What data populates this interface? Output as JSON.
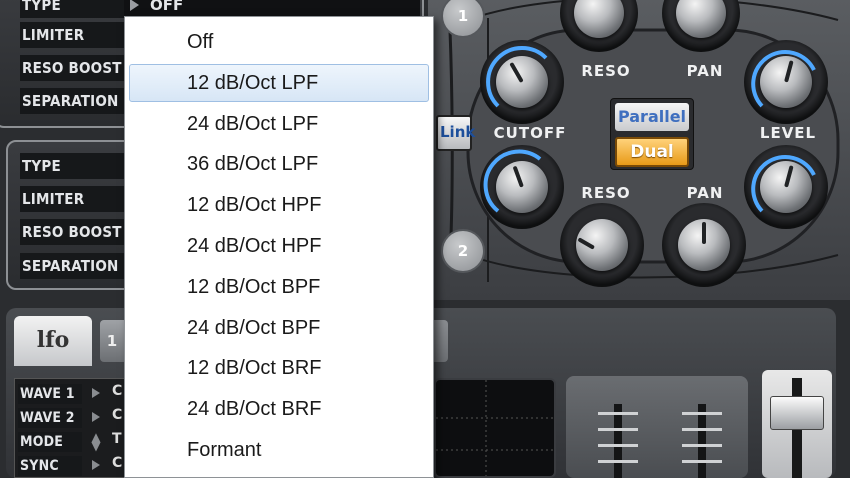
{
  "filter1": {
    "type_label": "TYPE",
    "type_value": "Off",
    "limiter_label": "LIMITER",
    "reso_boost_label": "RESO BOOST",
    "separation_label": "SEPARATION"
  },
  "filter2": {
    "type_label": "TYPE",
    "limiter_label": "LIMITER",
    "reso_boost_label": "RESO BOOST",
    "separation_label": "SEPARATION"
  },
  "filter_section": {
    "badge_1": "1",
    "badge_2": "2",
    "link_label": "Link",
    "parallel_label": "Parallel",
    "dual_label": "Dual",
    "reso_top_label": "RESO",
    "pan_top_label": "PAN",
    "cutoff_label": "CUTOFF",
    "level_label": "LEVEL",
    "reso_bottom_label": "RESO",
    "pan_bottom_label": "PAN"
  },
  "lfo": {
    "tab_label": "lfo",
    "tab2_partial": "1",
    "wave1_label": "WAVE 1",
    "wave2_label": "WAVE 2",
    "mode_label": "MODE",
    "sync_label": "SYNC",
    "wave1_value_partial": "C",
    "wave2_value_partial": "C",
    "mode_value_partial": "T",
    "sync_value_partial": "C"
  },
  "dropdown": {
    "selected_index": 1,
    "items": [
      "Off",
      "12 dB/Oct LPF",
      "24 dB/Oct LPF",
      "36 dB/Oct LPF",
      "12 dB/Oct HPF",
      "24 dB/Oct HPF",
      "12 dB/Oct BPF",
      "24 dB/Oct BPF",
      "12 dB/Oct BRF",
      "24 dB/Oct BRF",
      "Formant"
    ]
  },
  "colors": {
    "accent_orange": "#f0a020",
    "accent_blue": "#3f6fbf",
    "menu_highlight": "#d7e6f6"
  }
}
